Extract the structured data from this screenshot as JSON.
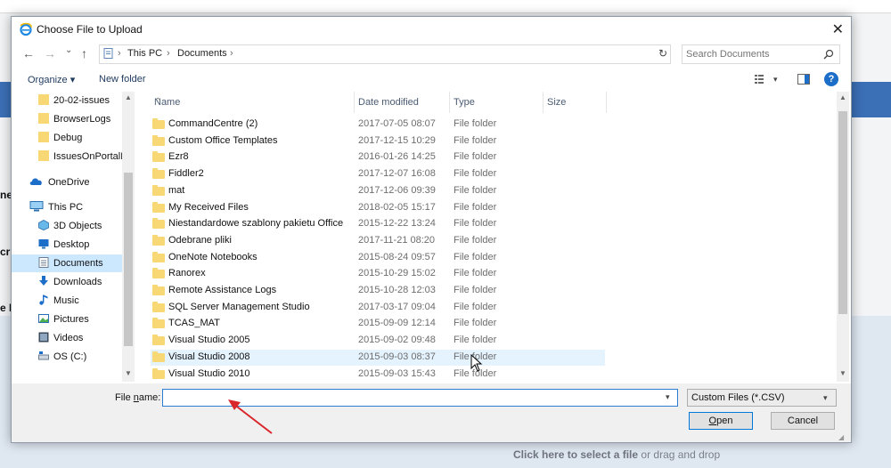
{
  "background": {
    "upload_prompt_bold": "Click here to select a file",
    "upload_prompt_rest": " or drag and drop",
    "fragments": [
      "ne",
      "cr",
      "e F"
    ]
  },
  "dialog": {
    "title": "Choose File to Upload",
    "close_glyph": "✕"
  },
  "nav": {
    "back_glyph": "←",
    "forward_glyph": "→",
    "history_glyph": "⌄",
    "up_glyph": "↑",
    "breadcrumb": [
      "This PC",
      "Documents"
    ],
    "separator": "›",
    "search_placeholder": "Search Documents"
  },
  "commands": {
    "organize": "Organize ▾",
    "new_folder": "New folder"
  },
  "sidebar": {
    "items": [
      {
        "label": "20-02-issues",
        "icon": "folder-icon"
      },
      {
        "label": "BrowserLogs",
        "icon": "folder-icon"
      },
      {
        "label": "Debug",
        "icon": "folder-icon"
      },
      {
        "label": "IssuesOnPortalF",
        "icon": "folder-icon"
      },
      {
        "label": "OneDrive",
        "icon": "cloud-icon"
      },
      {
        "label": "This PC",
        "icon": "computer-icon"
      },
      {
        "label": "3D Objects",
        "icon": "cube-icon"
      },
      {
        "label": "Desktop",
        "icon": "desktop-icon"
      },
      {
        "label": "Documents",
        "icon": "documents-icon",
        "selected": true
      },
      {
        "label": "Downloads",
        "icon": "download-icon"
      },
      {
        "label": "Music",
        "icon": "music-icon"
      },
      {
        "label": "Pictures",
        "icon": "pictures-icon"
      },
      {
        "label": "Videos",
        "icon": "videos-icon"
      },
      {
        "label": "OS (C:)",
        "icon": "drive-icon"
      }
    ]
  },
  "columns": {
    "name": "Name",
    "date": "Date modified",
    "type": "Type",
    "size": "Size"
  },
  "files": [
    {
      "name": "CommandCentre (2)",
      "date": "2017-07-05 08:07",
      "type": "File folder"
    },
    {
      "name": "Custom Office Templates",
      "date": "2017-12-15 10:29",
      "type": "File folder"
    },
    {
      "name": "Ezr8",
      "date": "2016-01-26 14:25",
      "type": "File folder"
    },
    {
      "name": "Fiddler2",
      "date": "2017-12-07 16:08",
      "type": "File folder"
    },
    {
      "name": "mat",
      "date": "2017-12-06 09:39",
      "type": "File folder"
    },
    {
      "name": "My Received Files",
      "date": "2018-02-05 15:17",
      "type": "File folder"
    },
    {
      "name": "Niestandardowe szablony pakietu Office",
      "date": "2015-12-22 13:24",
      "type": "File folder"
    },
    {
      "name": "Odebrane pliki",
      "date": "2017-11-21 08:20",
      "type": "File folder"
    },
    {
      "name": "OneNote Notebooks",
      "date": "2015-08-24 09:57",
      "type": "File folder"
    },
    {
      "name": "Ranorex",
      "date": "2015-10-29 15:02",
      "type": "File folder"
    },
    {
      "name": "Remote Assistance Logs",
      "date": "2015-10-28 12:03",
      "type": "File folder"
    },
    {
      "name": "SQL Server Management Studio",
      "date": "2017-03-17 09:04",
      "type": "File folder"
    },
    {
      "name": "TCAS_MAT",
      "date": "2015-09-09 12:14",
      "type": "File folder"
    },
    {
      "name": "Visual Studio 2005",
      "date": "2015-09-02 09:48",
      "type": "File folder"
    },
    {
      "name": "Visual Studio 2008",
      "date": "2015-09-03 08:37",
      "type": "File folder",
      "hover": true
    },
    {
      "name": "Visual Studio 2010",
      "date": "2015-09-03 15:43",
      "type": "File folder"
    }
  ],
  "footer": {
    "file_name_label_pre": "File ",
    "file_name_label_underlined": "n",
    "file_name_label_post": "ame:",
    "file_name_value": "",
    "filter_value": "Custom Files (*.CSV)",
    "open_underlined": "O",
    "open_rest": "pen",
    "cancel": "Cancel"
  },
  "colors": {
    "accent": "#0078d7",
    "selection": "#cce8ff",
    "hover": "#e5f3ff",
    "folder": "#f8d775",
    "annotation_arrow": "#d9262b"
  }
}
